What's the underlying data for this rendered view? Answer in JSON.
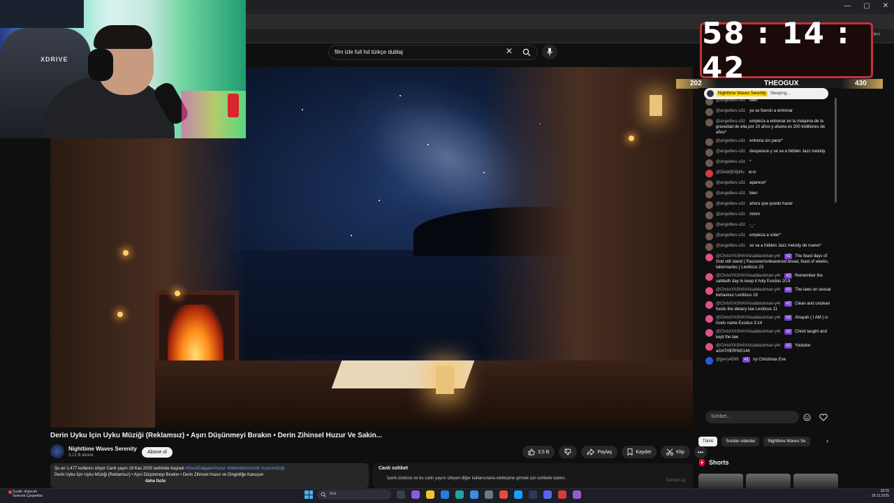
{
  "window": {
    "controls": [
      "—",
      "▢",
      "✕"
    ],
    "bookmarks_label": "işaretleri"
  },
  "search": {
    "query": "film izle full hd türkçe dublaj",
    "clear_label": "✕"
  },
  "webcam": {
    "chair_brand": "XDRIVE"
  },
  "timer": {
    "time": "58 : 14 : 42",
    "left_count": "202",
    "name": "THEOGUX",
    "right_count": "430"
  },
  "chat": {
    "pinned": {
      "author": "Nighttime Waves Serenity",
      "text": "Sleeping..."
    },
    "messages": [
      {
        "author": "@angelbes-u3z",
        "text": "bien",
        "avatar": "brown"
      },
      {
        "author": "@angelbes-u3z",
        "text": "ya se fueron a entrenar",
        "avatar": "brown"
      },
      {
        "author": "@angelbes-u3z",
        "text": "empieza a entrenar en la máquina de la gravedad de ella por 10 años y afuera es 200 tridillones de años*",
        "avatar": "brown"
      },
      {
        "author": "@angelbes-u3z",
        "text": "entrena sin parar*",
        "avatar": "brown"
      },
      {
        "author": "@angelbes-u3z",
        "text": "desparece y se va a hidden Jazz melody",
        "avatar": "brown"
      },
      {
        "author": "@angelbes-u3z",
        "text": "*",
        "avatar": "brown"
      },
      {
        "author": "@DkdkfjEifjdifu",
        "text": "w.m",
        "avatar": "red"
      },
      {
        "author": "@angelbes-u3z",
        "text": "aparece*",
        "avatar": "brown"
      },
      {
        "author": "@angelbes-u3z",
        "text": "bien",
        "avatar": "brown"
      },
      {
        "author": "@angelbes-u3z",
        "text": "ahora que puedo hacer",
        "avatar": "brown"
      },
      {
        "author": "@angelbes-u3z",
        "text": "mmm",
        "avatar": "brown"
      },
      {
        "author": "@angelbes-u3z",
        "text": "-_-",
        "avatar": "brown"
      },
      {
        "author": "@angelbes-u3z",
        "text": "empieza a volar*",
        "avatar": "brown"
      },
      {
        "author": "@angelbes-u3z",
        "text": "se va a hidden Jazz melody de nuevo*",
        "avatar": "brown"
      },
      {
        "author": "@ChristYASHAYAisablackman-y4r",
        "badge": "#2",
        "text": "The feast days of God still stand ( Passover/unleavened bread, feast of weeks, tabernacles ) Leviticus 23",
        "avatar": "pink"
      },
      {
        "author": "@ChristYASHAYAisablackman-y4r",
        "badge": "#2",
        "text": "Remember the sabbath day to keep it holy Exodus 20:8",
        "avatar": "pink"
      },
      {
        "author": "@ChristYASHAYAisablackman-y4r",
        "badge": "#2",
        "text": "The laws on sexual behaviour Leviticus 18",
        "avatar": "pink"
      },
      {
        "author": "@ChristYASHAYAisablackman-y4r",
        "badge": "#2",
        "text": "Clean and unclean foods the dietary law Leviticus 11",
        "avatar": "pink"
      },
      {
        "author": "@ChristYASHAYAisablackman-y4r",
        "badge": "#2",
        "text": "Ahayah ( I AM ) is Gods name Exodus 3:14",
        "avatar": "pink"
      },
      {
        "author": "@ChristYASHAYAisablackman-y4r",
        "badge": "#2",
        "text": "Christ taught and kept the law",
        "avatar": "pink"
      },
      {
        "author": "@ChristYASHAYAisablackman-y4r",
        "badge": "#2",
        "text": "Youtube: aGATHERING144",
        "avatar": "pink"
      },
      {
        "author": "@jjerry4569",
        "badge": "#1",
        "text": "ny Christmas Eve",
        "avatar": "blue"
      }
    ],
    "input_placeholder": "Sohbet..."
  },
  "video": {
    "title": "Derin Uyku İçin Uyku Müziği (Reklamsız) • Aşırı Düşünmeyi Bırakın • Derin Zihinsel Huzur Ve Sakin...",
    "channel": "Nighttime Waves Serenity",
    "subscribers": "3,12 B abone",
    "subscribe_label": "Abone ol",
    "likes": "3,5 B",
    "share_label": "Paylaş",
    "save_label": "Kaydet",
    "clip_label": "Klip",
    "more_label": "•••"
  },
  "description": {
    "stats": "Şu an 1.477 kullanıcı izliyor  Canlı yayın 19 Kas 2025 tarihinde başladı",
    "hashtags": "#GeceDalgalarıHuzur #dinlendiricimüzik #uykumüziği",
    "line2": "Derin Uyku İçin Uyku Müziği (Reklamsız) • Aşırı Düşünmeyi Bırakın • Derin Zihinsel Huzur ve Dinginliğe Kavuşun",
    "more": "daha fazla"
  },
  "livechat": {
    "heading": "Canlı sohbet",
    "text": "İçerik üreticisi ve bu canlı yayını izleyen diğer kullanıcılarla etkileşime girmek için sohbete katılın.",
    "button": "Sohbeti aç"
  },
  "right": {
    "tabs": [
      {
        "label": "Tümü",
        "active": true
      },
      {
        "label": "Sordan videolar",
        "active": false
      },
      {
        "label": "Nighttime Waves Se",
        "active": false
      }
    ],
    "next": "›",
    "shorts_label": "Shorts"
  },
  "taskbar": {
    "weather_title": "Sıcakl. düşecek",
    "weather_sub": "Gelecek Çarşamba",
    "search_placeholder": "Ara",
    "time": "18:15",
    "date": "26.12.2025"
  },
  "colors": {
    "background": "#0f0f0f",
    "timer_border": "#c0353a",
    "badge": "#7a3dd6",
    "highlight": "#ffd600"
  }
}
